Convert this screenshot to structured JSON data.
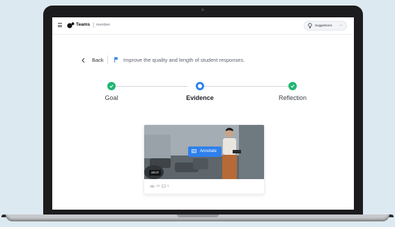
{
  "header": {
    "brand": "Teams",
    "role": "member",
    "suggestions_label": "Suggestions",
    "suggestions_arrow": "→"
  },
  "goal_bar": {
    "back_label": "Back",
    "goal_text": "Improve the quality and length of student responses."
  },
  "stepper": {
    "steps": [
      {
        "label": "Goal",
        "state": "done"
      },
      {
        "label": "Evidence",
        "state": "current"
      },
      {
        "label": "Reflection",
        "state": "done"
      }
    ]
  },
  "video": {
    "annotate_label": "Annotate",
    "duration": "28:07",
    "views": "18",
    "comments": "3"
  },
  "colors": {
    "accent": "#2f80ed",
    "success": "#22b573",
    "background": "#dde9f1"
  },
  "icons": [
    "menu-icon",
    "teams-logo-icon",
    "lightbulb-icon",
    "chevron-left-icon",
    "flag-icon",
    "check-icon",
    "annotate-icon",
    "eye-icon",
    "comment-icon"
  ]
}
